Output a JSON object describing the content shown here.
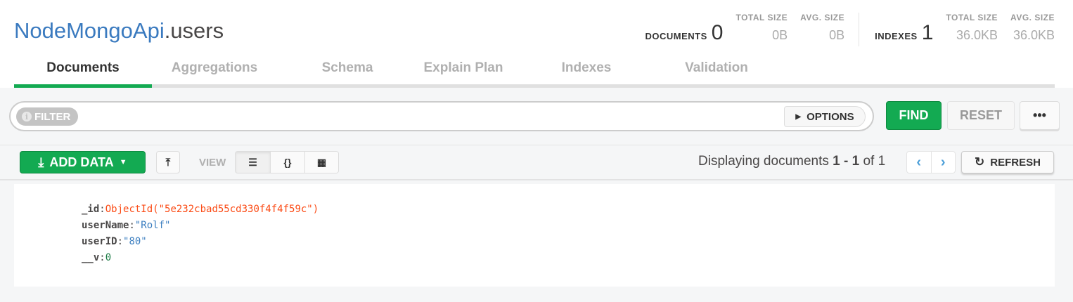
{
  "header": {
    "db": "NodeMongoApi",
    "collection": ".users",
    "documents": {
      "label": "DOCUMENTS",
      "count": "0",
      "total_size_label": "TOTAL SIZE",
      "total_size": "0B",
      "avg_size_label": "AVG. SIZE",
      "avg_size": "0B"
    },
    "indexes": {
      "label": "INDEXES",
      "count": "1",
      "total_size_label": "TOTAL SIZE",
      "total_size": "36.0KB",
      "avg_size_label": "AVG. SIZE",
      "avg_size": "36.0KB"
    }
  },
  "tabs": [
    {
      "label": "Documents",
      "active": true
    },
    {
      "label": "Aggregations"
    },
    {
      "label": "Schema"
    },
    {
      "label": "Explain Plan"
    },
    {
      "label": "Indexes"
    },
    {
      "label": "Validation"
    }
  ],
  "filter": {
    "label": "FILTER",
    "value": "",
    "options_label": "OPTIONS",
    "find_label": "FIND",
    "reset_label": "RESET",
    "more_label": "•••"
  },
  "toolbar": {
    "add_data_label": "ADD DATA",
    "view_label": "VIEW",
    "display_prefix": "Displaying documents",
    "range": "1 - 1",
    "of": "of",
    "total": "1",
    "refresh_label": "REFRESH"
  },
  "document": [
    {
      "key": "_id",
      "value": "ObjectId(\"5e232cbad55cd330f4f4f59c\")",
      "type": "oid"
    },
    {
      "key": "userName",
      "value": "\"Rolf\"",
      "type": "str"
    },
    {
      "key": "userID",
      "value": "\"80\"",
      "type": "str"
    },
    {
      "key": "__v",
      "value": "0",
      "type": "num"
    }
  ],
  "colors": {
    "accent": "#13aa52",
    "db_title": "#3a7abf",
    "objectid": "#fb4a14",
    "string": "#3d7fc0",
    "number": "#1c7c45"
  }
}
